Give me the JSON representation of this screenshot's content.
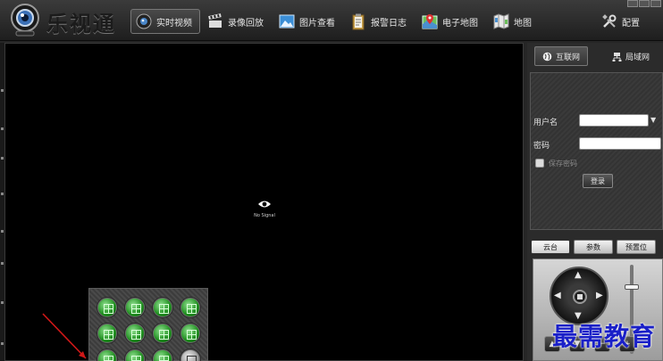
{
  "app": {
    "title": "乐视通"
  },
  "nav": {
    "items": [
      {
        "label": "实时视频",
        "icon": "webcam-icon",
        "active": true
      },
      {
        "label": "录像回放",
        "icon": "film-icon",
        "active": false
      },
      {
        "label": "图片查看",
        "icon": "picture-icon",
        "active": false
      },
      {
        "label": "报警日志",
        "icon": "clipboard-icon",
        "active": false
      },
      {
        "label": "电子地图",
        "icon": "map-pin-icon",
        "active": false
      },
      {
        "label": "地图",
        "icon": "map-icon",
        "active": false
      }
    ],
    "config_label": "配置"
  },
  "video": {
    "status_text": "No Signal"
  },
  "network": {
    "tabs": [
      {
        "label": "互联网",
        "icon": "globe-icon",
        "active": true
      },
      {
        "label": "局域网",
        "icon": "lan-icon",
        "active": false
      }
    ]
  },
  "login": {
    "username_label": "用户名",
    "username_value": "",
    "password_label": "密码",
    "password_value": "",
    "remember_label": "保存密码",
    "remember_checked": false,
    "login_button": "登录"
  },
  "ptz": {
    "tabs": [
      {
        "label": "云台",
        "active": true
      },
      {
        "label": "参数",
        "active": false
      },
      {
        "label": "预置位",
        "active": false
      }
    ],
    "zoom_level": 0.75
  },
  "layout_buttons": {
    "icons": [
      "layout-1-icon",
      "layout-4-icon",
      "layout-6-icon",
      "layout-9-icon",
      "layout-8-icon",
      "layout-13-icon",
      "layout-16-icon",
      "layout-25-icon",
      "layout-3-icon",
      "layout-2-icon",
      "layout-12-icon",
      "camera-icon"
    ]
  },
  "watermark": {
    "text": "最需教育"
  },
  "colors": {
    "accent_green": "#1f8f1f",
    "watermark_blue": "#1a20c8",
    "arrow_red": "#d01818"
  }
}
